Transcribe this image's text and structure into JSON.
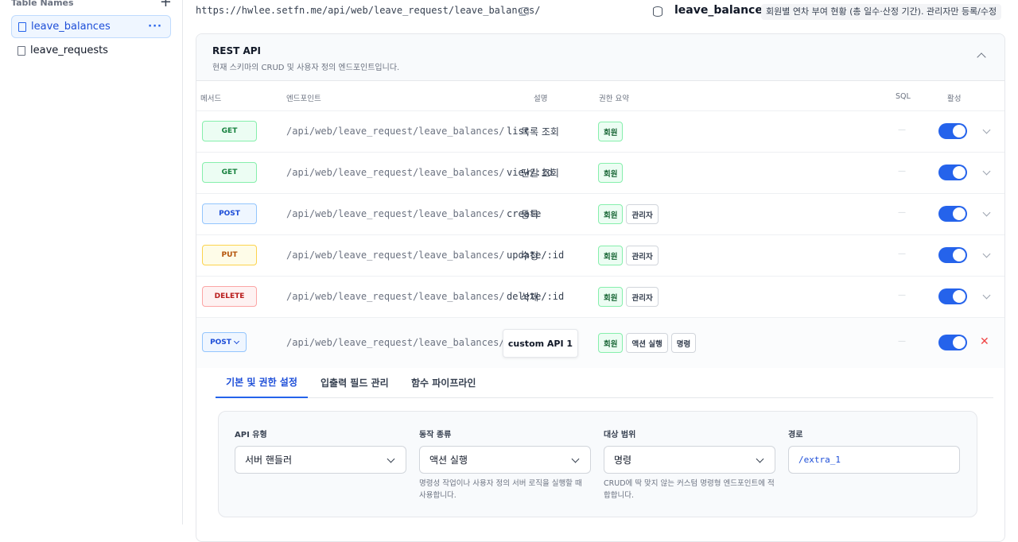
{
  "sidebar": {
    "title": "Table Names",
    "add_icon": "plus-icon",
    "items": [
      {
        "label": "leave_balances",
        "active": true
      },
      {
        "label": "leave_requests",
        "active": false
      }
    ]
  },
  "header": {
    "url": "https://hwlee.setfn.me/api/web/leave_request/leave_balances/",
    "table_name": "leave_balances",
    "table_desc": "회원별 연차 부여 현황 (총 일수·산정 기간). 관리자만 등록/수정"
  },
  "panel": {
    "title": "REST API",
    "subtitle": "현재 스키마의 CRUD 및 사용자 정의 엔드포인트입니다.",
    "columns": {
      "method": "메서드",
      "endpoint": "엔드포인트",
      "desc": "설명",
      "perm": "권한 요약",
      "sql": "SQL",
      "active": "활성"
    },
    "rows": [
      {
        "method": "GET",
        "endpoint": "/api/web/leave_request/leave_balances/",
        "suffix": "list",
        "desc": "목록 조회",
        "perms": [
          "회원"
        ],
        "sql": "—"
      },
      {
        "method": "GET",
        "endpoint": "/api/web/leave_request/leave_balances/",
        "suffix": "view/:id",
        "desc": "단일 조회",
        "perms": [
          "회원"
        ],
        "sql": "—"
      },
      {
        "method": "POST",
        "endpoint": "/api/web/leave_request/leave_balances/",
        "suffix": "create",
        "desc": "등록",
        "perms": [
          "회원",
          "관리자"
        ],
        "sql": "—"
      },
      {
        "method": "PUT",
        "endpoint": "/api/web/leave_request/leave_balances/",
        "suffix": "update/:id",
        "desc": "수정",
        "perms": [
          "회원",
          "관리자"
        ],
        "sql": "—"
      },
      {
        "method": "DELETE",
        "endpoint": "/api/web/leave_request/leave_balances/",
        "suffix": "delete/:id",
        "desc": "삭제",
        "perms": [
          "회원",
          "관리자"
        ],
        "sql": "—"
      }
    ],
    "custom_row": {
      "method": "POST",
      "endpoint": "/api/web/leave_request/leave_balances/",
      "name": "custom API 1",
      "perms": [
        "회원",
        "액션 실행",
        "명령"
      ],
      "sql": "—",
      "close": "✕"
    }
  },
  "tabs": [
    "기본 및 권한 설정",
    "입출력 필드 관리",
    "함수 파이프라인"
  ],
  "settings": {
    "api_type": {
      "label": "API 유형",
      "value": "서버 핸들러"
    },
    "action_kind": {
      "label": "동작 종류",
      "value": "액션 실행",
      "help": "명령성 작업이나 사용자 정의 서버 로직을 실행할 때 사용합니다."
    },
    "scope": {
      "label": "대상 범위",
      "value": "명령",
      "help": "CRUD에 딱 맞지 않는 커스텀 명령형 엔드포인트에 적합합니다."
    },
    "path": {
      "label": "경로",
      "value": "/extra_1"
    }
  }
}
